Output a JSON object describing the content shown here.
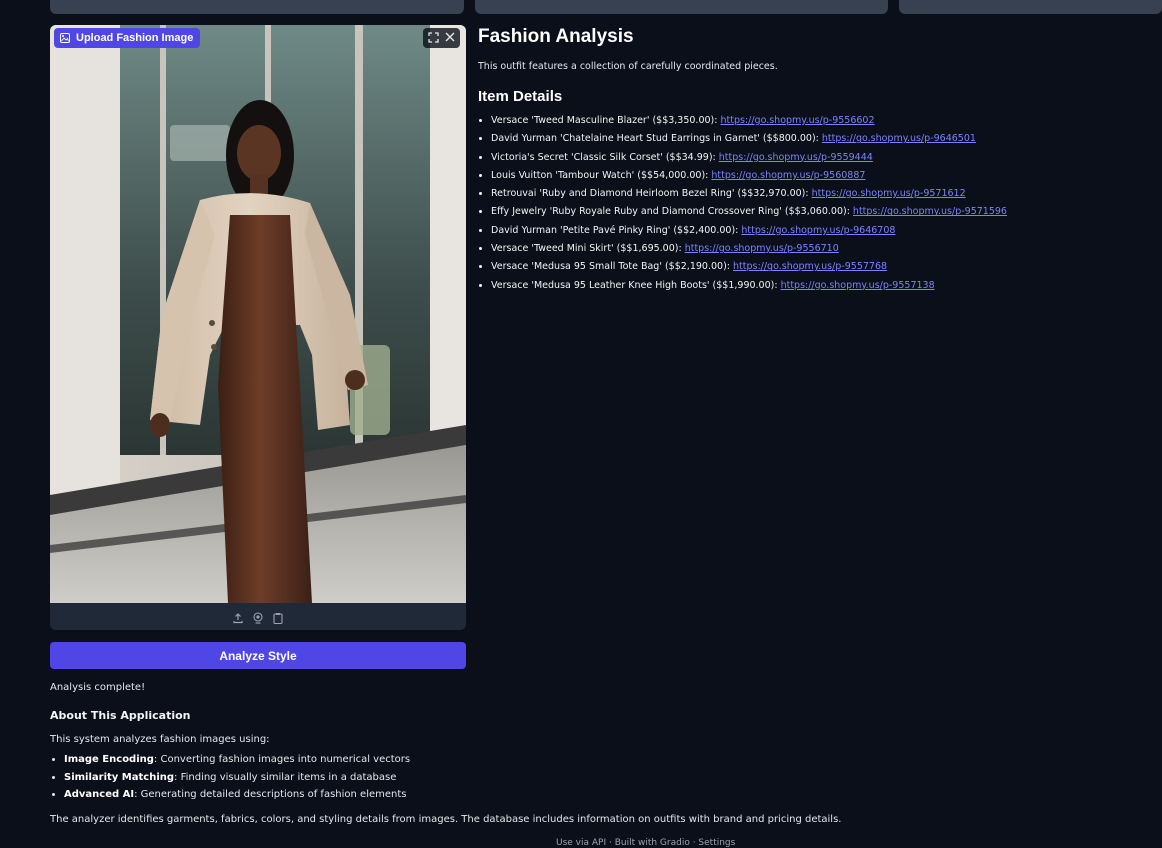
{
  "image_panel": {
    "upload_label": "Upload Fashion Image",
    "tools": {
      "fullscreen_icon": "fullscreen-icon",
      "close_icon": "close-icon"
    },
    "footer_icons": [
      "upload-icon",
      "webcam-icon",
      "clipboard-icon"
    ]
  },
  "analyze_button": "Analyze Style",
  "status": "Analysis complete!",
  "about": {
    "title": "About This Application",
    "intro": "This system analyzes fashion images using:",
    "features": [
      {
        "name": "Image Encoding",
        "desc": ": Converting fashion images into numerical vectors"
      },
      {
        "name": "Similarity Matching",
        "desc": ": Finding visually similar items in a database"
      },
      {
        "name": "Advanced AI",
        "desc": ": Generating detailed descriptions of fashion elements"
      }
    ],
    "summary": "The analyzer identifies garments, fabrics, colors, and styling details from images. The database includes information on outfits with brand and pricing details."
  },
  "footer": "Use via API · Built with Gradio · Settings",
  "analysis": {
    "title": "Fashion Analysis",
    "description": "This outfit features a collection of carefully coordinated pieces.",
    "items_title": "Item Details",
    "items": [
      {
        "text": "Versace 'Tweed Masculine Blazer' ($$3,350.00): ",
        "link": "https://go.shopmy.us/p-9556602"
      },
      {
        "text": "David Yurman 'Chatelaine Heart Stud Earrings in Garnet' ($$800.00): ",
        "link": "https://go.shopmy.us/p-9646501"
      },
      {
        "text": "Victoria's Secret 'Classic Silk Corset' ($$34.99): ",
        "link": "https://go.shopmy.us/p-9559444"
      },
      {
        "text": "Louis Vuitton 'Tambour Watch' ($$54,000.00): ",
        "link": "https://go.shopmy.us/p-9560887"
      },
      {
        "text": "Retrouvai 'Ruby and Diamond Heirloom Bezel Ring' ($$32,970.00): ",
        "link": "https://go.shopmy.us/p-9571612"
      },
      {
        "text": "Effy Jewelry 'Ruby Royale Ruby and Diamond Crossover Ring' ($$3,060.00): ",
        "link": "https://go.shopmy.us/p-9571596"
      },
      {
        "text": "David Yurman 'Petite Pavé Pinky Ring' ($$2,400.00): ",
        "link": "https://go.shopmy.us/p-9646708"
      },
      {
        "text": "Versace 'Tweed Mini Skirt' ($$1,695.00): ",
        "link": "https://go.shopmy.us/p-9556710"
      },
      {
        "text": "Versace 'Medusa 95 Small Tote Bag' ($$2,190.00): ",
        "link": "https://go.shopmy.us/p-9557768"
      },
      {
        "text": "Versace 'Medusa 95 Leather Knee High Boots' ($$1,990.00): ",
        "link": "https://go.shopmy.us/p-9557138"
      }
    ]
  }
}
